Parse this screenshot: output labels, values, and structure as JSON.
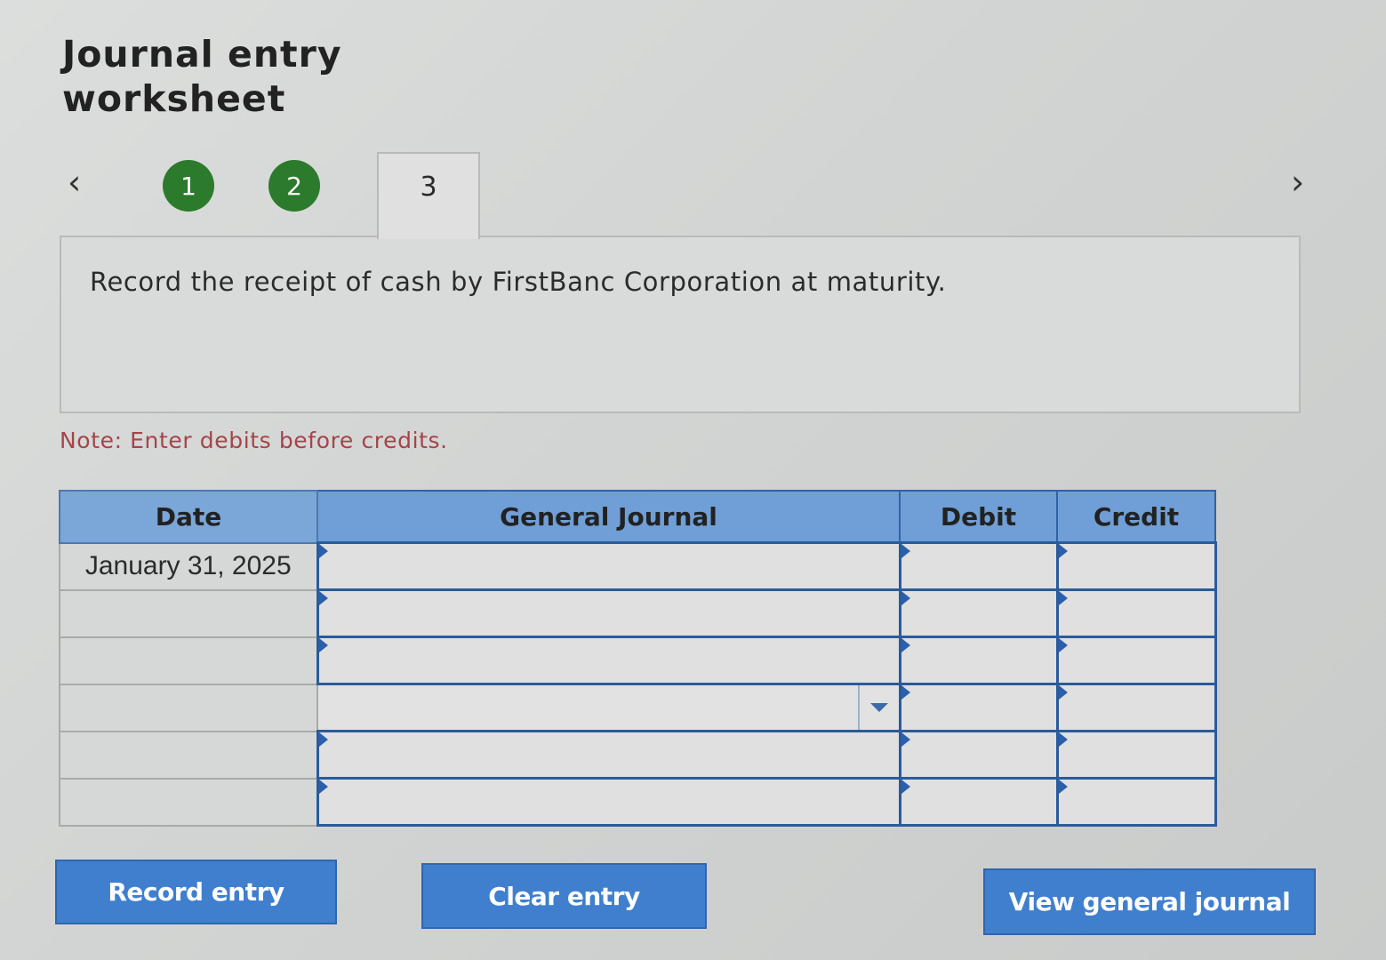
{
  "title": {
    "line1": "Journal entry",
    "line2": "worksheet"
  },
  "navigation": {
    "prev_icon": "chevron-left-icon",
    "next_icon": "chevron-right-icon",
    "steps": [
      {
        "label": "1",
        "state": "completed"
      },
      {
        "label": "2",
        "state": "completed"
      },
      {
        "label": "3",
        "state": "active"
      }
    ],
    "completed_color": "#2c7a2c"
  },
  "prompt": {
    "text": "Record the receipt of cash by FirstBanc Corporation at maturity."
  },
  "note": {
    "text": "Note: Enter debits before credits.",
    "color": "#a3454a"
  },
  "table": {
    "header_color": "#6f9fd6",
    "columns": [
      "Date",
      "General Journal",
      "Debit",
      "Credit"
    ],
    "rows": [
      {
        "date": "January 31, 2025",
        "account": "",
        "debit": "",
        "credit": ""
      },
      {
        "date": "",
        "account": "",
        "debit": "",
        "credit": ""
      },
      {
        "date": "",
        "account": "",
        "debit": "",
        "credit": ""
      },
      {
        "date": "",
        "account": "",
        "debit": "",
        "credit": "",
        "account_is_dropdown": true
      },
      {
        "date": "",
        "account": "",
        "debit": "",
        "credit": ""
      },
      {
        "date": "",
        "account": "",
        "debit": "",
        "credit": ""
      }
    ]
  },
  "buttons": {
    "record": "Record entry",
    "clear": "Clear entry",
    "view": "View general journal",
    "color": "#3f7fce"
  }
}
